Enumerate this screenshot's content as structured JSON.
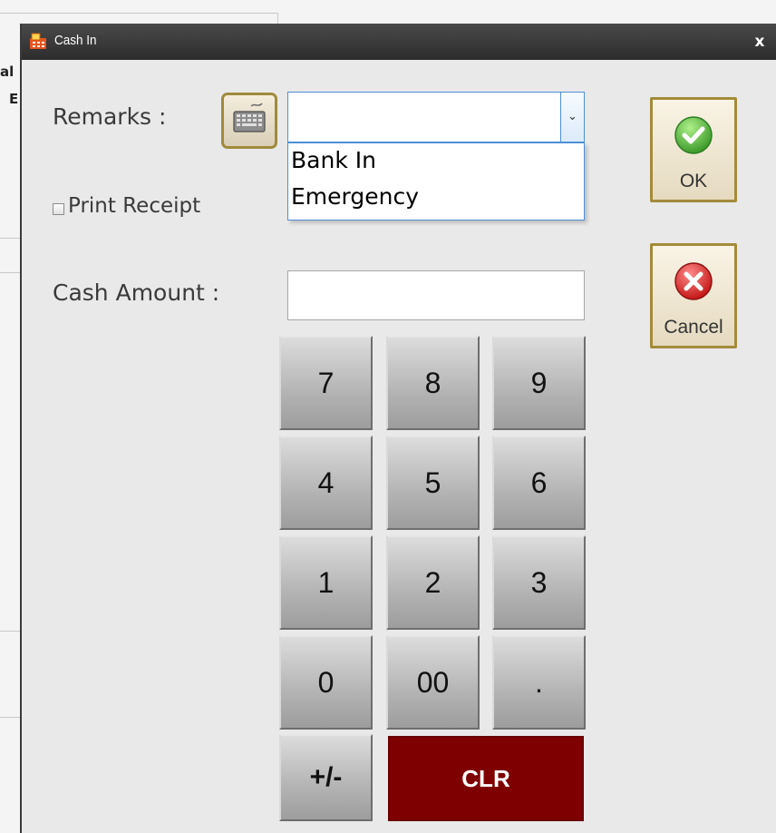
{
  "background": {
    "partial_labels": [
      "al",
      "E"
    ]
  },
  "dialog": {
    "title": "Cash In",
    "close_label": "x"
  },
  "remarks": {
    "label": "Remarks :",
    "value": "",
    "options": [
      "Bank In",
      "Emergency"
    ]
  },
  "print_receipt": {
    "label": "Print Receipt",
    "checked": false
  },
  "cash_amount": {
    "label": "Cash Amount :",
    "value": ""
  },
  "keypad": {
    "keys": [
      "7",
      "8",
      "9",
      "4",
      "5",
      "6",
      "1",
      "2",
      "3",
      "0",
      "00",
      ".",
      "+/-"
    ],
    "clear_label": "CLR"
  },
  "actions": {
    "ok_label": "OK",
    "cancel_label": "Cancel"
  },
  "colors": {
    "clr_button": "#7f0000",
    "titlebar": "#2c2c2c",
    "ok_icon": "#4caf50",
    "cancel_icon": "#d62a2a"
  },
  "icons": {
    "app": "cash-register-icon",
    "keyboard": "keyboard-icon",
    "ok": "check-circle-icon",
    "cancel": "x-circle-icon"
  }
}
